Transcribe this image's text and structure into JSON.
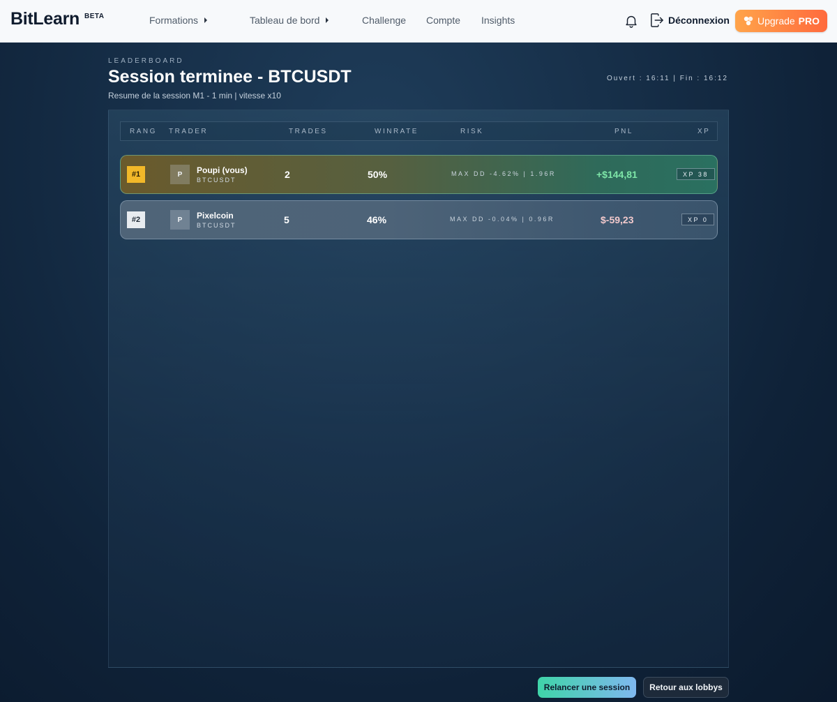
{
  "nav": {
    "logo": "BitLearn",
    "beta": "BETA",
    "items": [
      {
        "label": "Formations",
        "caret": true
      },
      {
        "label": "Tableau de bord",
        "caret": true
      },
      {
        "label": "Challenge",
        "caret": false
      },
      {
        "label": "Compte",
        "caret": false
      },
      {
        "label": "Insights",
        "caret": false
      }
    ],
    "logout_label": "Déconnexion",
    "upgrade_label": "Upgrade",
    "upgrade_pro": "PRO",
    "icons": [
      "bell-icon",
      "logout-icon",
      "sparkle-icon"
    ]
  },
  "header": {
    "kicker": "LEADERBOARD",
    "title": "Session terminee - BTCUSDT",
    "subtitle": "Resume de la session M1 - 1 min | vitesse x10",
    "times": "Ouvert : 16:11 | Fin : 16:12"
  },
  "table": {
    "columns": [
      "RANG",
      "TRADER",
      "TRADES",
      "WINRATE",
      "RISK",
      "PNL",
      "XP"
    ],
    "rows": [
      {
        "rank": "#1",
        "avatar": "P",
        "name": "Poupi (vous)",
        "symbol": "BTCUSDT",
        "trades": "2",
        "winrate": "50%",
        "risk": "MAX DD -4.62% | 1.96R",
        "pnl": "+$144,81",
        "xp": "XP 38"
      },
      {
        "rank": "#2",
        "avatar": "P",
        "name": "Pixelcoin",
        "symbol": "BTCUSDT",
        "trades": "5",
        "winrate": "46%",
        "risk": "MAX DD -0.04% | 0.96R",
        "pnl": "$-59,23",
        "xp": "XP 0"
      }
    ]
  },
  "footer": {
    "relaunch_label": "Relancer une session",
    "return_label": "Retour aux lobbys"
  },
  "colors": {
    "accent_orange": "#ff6a3d",
    "gold_rank": "#f2b829",
    "pnl_positive": "#7ee6a8",
    "pnl_negative": "#f2c9cc",
    "background": "#17304a"
  }
}
